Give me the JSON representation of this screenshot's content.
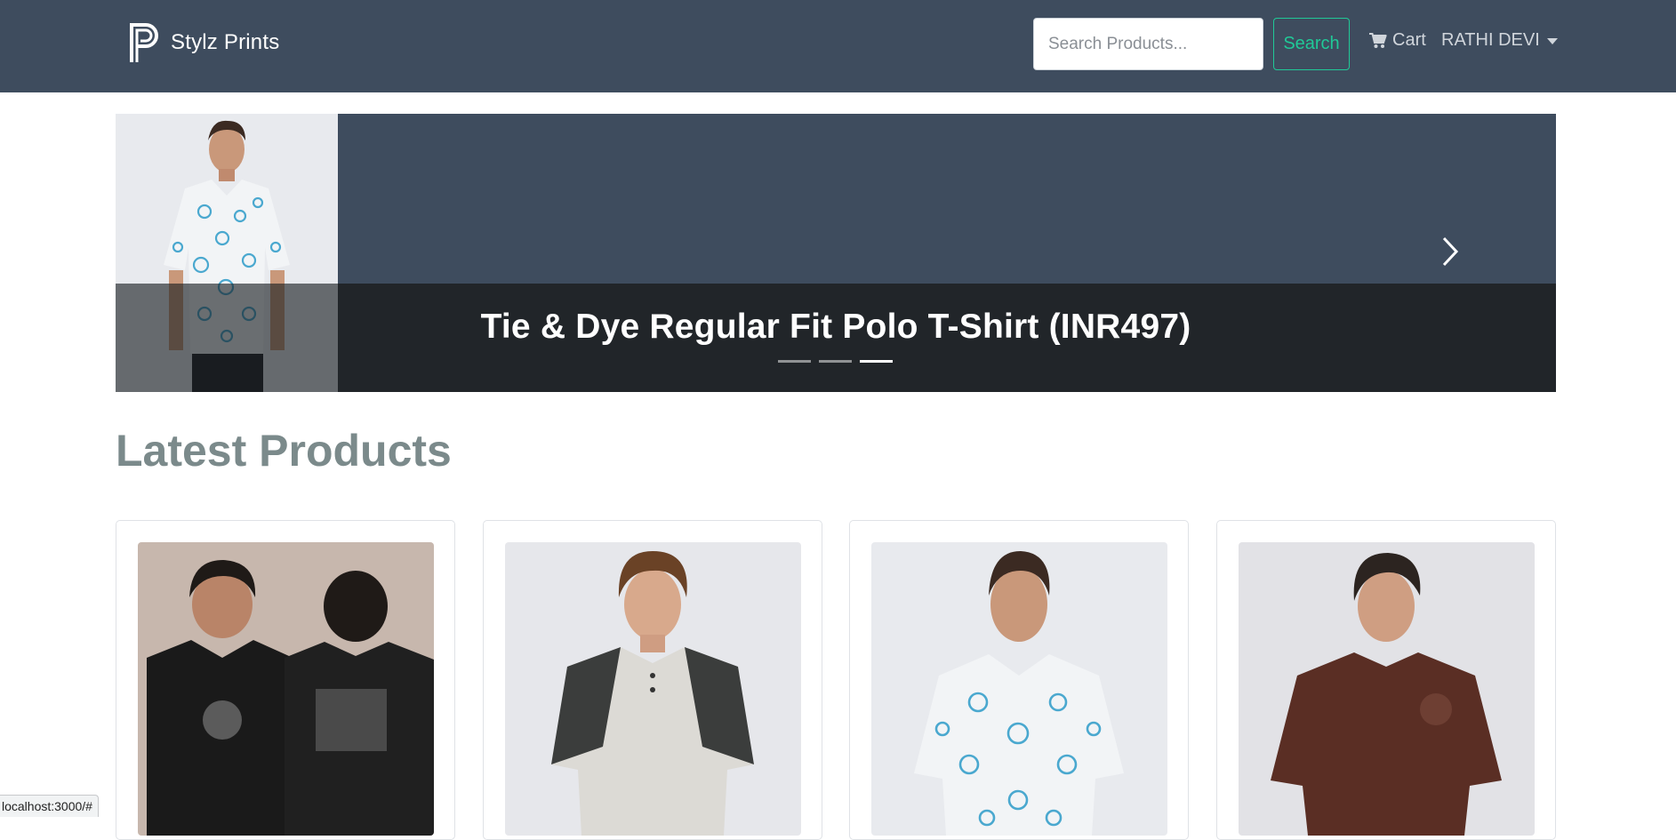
{
  "navbar": {
    "brand": "Stylz Prints",
    "search_placeholder": "Search Products...",
    "search_button": "Search",
    "cart_label": "Cart",
    "user_name": "RATHI DEVI",
    "colors": {
      "background": "#3e4c5e",
      "accent": "#20c997"
    }
  },
  "carousel": {
    "caption": "Tie & Dye Regular Fit Polo T-Shirt (INR497)",
    "slide_count": 3,
    "active_slide": 3
  },
  "latest": {
    "title": "Latest Products",
    "products": [
      {
        "image": "black-graphic-tshirt"
      },
      {
        "image": "grey-raglan-henley-tshirt"
      },
      {
        "image": "tie-dye-polo-tshirt"
      },
      {
        "image": "brown-oversized-tshirt"
      }
    ]
  },
  "status_bar": {
    "url": "localhost:3000/#"
  }
}
